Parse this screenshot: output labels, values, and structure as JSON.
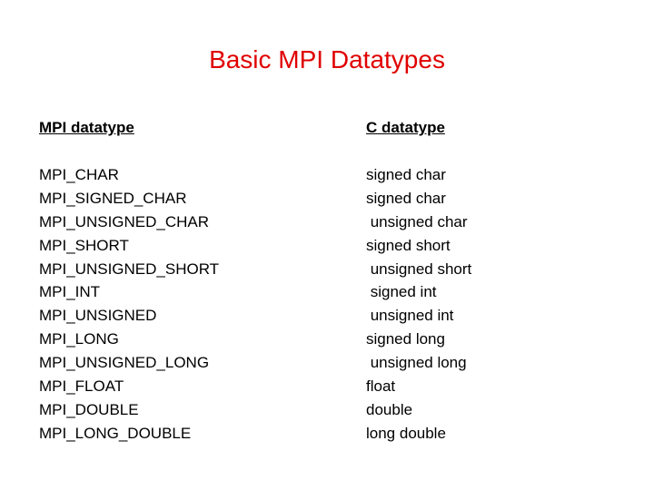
{
  "slide": {
    "title": "Basic MPI Datatypes",
    "title_color": "#e00000",
    "headers": {
      "mpi": "MPI datatype",
      "c": "C datatype"
    },
    "rows": [
      {
        "mpi": "MPI_CHAR",
        "c": "signed char"
      },
      {
        "mpi": "MPI_SIGNED_CHAR",
        "c": "signed char"
      },
      {
        "mpi": "MPI_UNSIGNED_CHAR",
        "c": " unsigned char"
      },
      {
        "mpi": "MPI_SHORT",
        "c": "signed short"
      },
      {
        "mpi": "MPI_UNSIGNED_SHORT",
        "c": " unsigned short"
      },
      {
        "mpi": "MPI_INT",
        "c": " signed int"
      },
      {
        "mpi": "MPI_UNSIGNED",
        "c": " unsigned int"
      },
      {
        "mpi": "MPI_LONG",
        "c": "signed long"
      },
      {
        "mpi": "MPI_UNSIGNED_LONG",
        "c": " unsigned long"
      },
      {
        "mpi": "MPI_FLOAT",
        "c": "float"
      },
      {
        "mpi": "MPI_DOUBLE",
        "c": "double"
      },
      {
        "mpi": "MPI_LONG_DOUBLE",
        "c": "long double"
      }
    ]
  }
}
